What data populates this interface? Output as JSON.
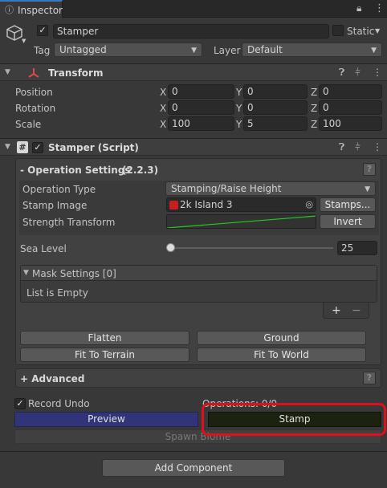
{
  "tab": {
    "label": "Inspector"
  },
  "gameobject": {
    "name": "Stamper",
    "static_label": "Static",
    "tag_label": "Tag",
    "tag_value": "Untagged",
    "layer_label": "Layer",
    "layer_value": "Default"
  },
  "transform": {
    "title": "Transform",
    "rows": [
      {
        "label": "Position",
        "x": "0",
        "y": "0",
        "z": "0"
      },
      {
        "label": "Rotation",
        "x": "0",
        "y": "0",
        "z": "0"
      },
      {
        "label": "Scale",
        "x": "100",
        "y": "5",
        "z": "100"
      }
    ],
    "axes": {
      "x": "X",
      "y": "Y",
      "z": "Z"
    }
  },
  "stamper": {
    "title": "Stamper (Script)",
    "script_icon": "#",
    "operation_settings": {
      "title": "- Operation Settings",
      "version": "(2.2.3)",
      "help": "?",
      "operation_type_label": "Operation Type",
      "operation_type_value": "Stamping/Raise Height",
      "stamp_image_label": "Stamp Image",
      "stamp_image_value": "2k Island 3",
      "stamps_button": "Stamps...",
      "strength_transform_label": "Strength Transform",
      "invert_button": "Invert",
      "sea_level_label": "Sea Level",
      "sea_level_value": "25",
      "sea_level_fraction": 0.0,
      "mask_settings_title": "Mask Settings [0]",
      "mask_empty_text": "List is Empty",
      "add_symbol": "+",
      "remove_symbol": "−",
      "flatten_button": "Flatten",
      "ground_button": "Ground",
      "fit_to_terrain_button": "Fit To Terrain",
      "fit_to_world_button": "Fit To World"
    },
    "advanced": {
      "title": "+ Advanced",
      "help": "?"
    },
    "record_undo_label": "Record Undo",
    "operations_text": "Operations: 0/0",
    "preview_button": "Preview",
    "stamp_button": "Stamp",
    "spawn_biome_button": "Spawn Biome"
  },
  "add_component_button": "Add Component",
  "colors": {
    "preview_button": "#313478",
    "stamp_button": "#1b2210",
    "highlight": "#e0101a",
    "curve": "#22cc22",
    "tab_accent": "#3a79bb"
  }
}
